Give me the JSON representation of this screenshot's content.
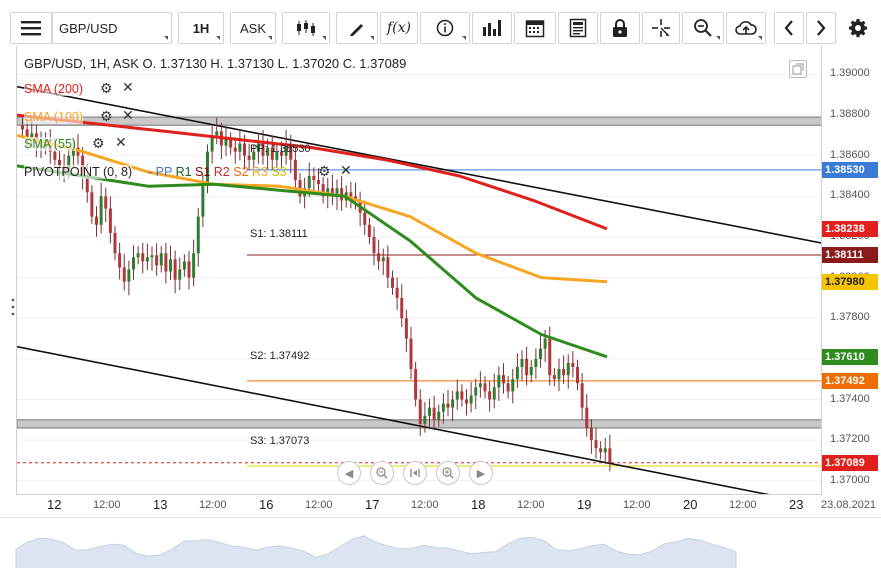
{
  "toolbar": {
    "symbol": "GBP/USD",
    "timeframe": "1H",
    "price_type": "ASK",
    "icons": [
      "menu-icon",
      "candles-icon",
      "draw-pencil-icon",
      "function-icon",
      "info-icon",
      "bar-chart-icon",
      "calendar-icon",
      "document-icon",
      "lock-icon",
      "crosshair-icon",
      "zoom-icon",
      "cloud-upload-icon",
      "chevron-left-icon",
      "chevron-right-icon",
      "gear-icon"
    ]
  },
  "ohlc": {
    "text": "GBP/USD, 1H, ASK    O. 1.37130  H. 1.37130  L. 1.37020  C. 1.37089"
  },
  "indicators": [
    {
      "label": "SMA (200)",
      "color": "#e0201c"
    },
    {
      "label": "SMA (100)",
      "color": "#f5a623"
    },
    {
      "label": "SMA (55)",
      "color": "#2e8b1e"
    },
    {
      "label": "PIVOTPOINT (0, 8)",
      "color": "#222222"
    }
  ],
  "pivot_legend": [
    {
      "label": "PP",
      "color": "#3a7bd5"
    },
    {
      "label": "R1",
      "color": "#1b5e20"
    },
    {
      "label": "S1",
      "color": "#8b0000"
    },
    {
      "label": "R2",
      "color": "#c62828"
    },
    {
      "label": "S2",
      "color": "#ef6c00"
    },
    {
      "label": "R3",
      "color": "#f9a825"
    },
    {
      "label": "S3",
      "color": "#d4c000"
    }
  ],
  "levels": [
    {
      "name": "PP",
      "label": "PP: 1.38530",
      "value": 1.3853,
      "color": "#3a7bd5"
    },
    {
      "name": "S1",
      "label": "S1: 1.38111",
      "value": 1.38111,
      "color": "#8b1a1a"
    },
    {
      "name": "S2",
      "label": "S2: 1.37492",
      "value": 1.37492,
      "color": "#ef6c00"
    },
    {
      "name": "S3",
      "label": "S3: 1.37073",
      "value": 1.37073,
      "color": "#e6d800"
    }
  ],
  "price_badges": [
    {
      "text": "1.38530",
      "value": 1.3853,
      "color": "#3a7bd5"
    },
    {
      "text": "1.38238",
      "value": 1.38238,
      "color": "#e0201c"
    },
    {
      "text": "1.38111",
      "value": 1.38111,
      "color": "#8b1a1a"
    },
    {
      "text": "1.37980",
      "value": 1.3798,
      "color": "#f5c400"
    },
    {
      "text": "1.37610",
      "value": 1.3761,
      "color": "#2e8b1e"
    },
    {
      "text": "1.37492",
      "value": 1.37492,
      "color": "#ef6c00"
    },
    {
      "text": "1.37089",
      "value": 1.37089,
      "color": "#e0201c"
    }
  ],
  "yaxis": {
    "ticks": [
      "1.39000",
      "1.38800",
      "1.38600",
      "1.38400",
      "1.38200",
      "1.38000",
      "1.37800",
      "1.37600",
      "1.37400",
      "1.37200",
      "1.37000"
    ],
    "values": [
      1.39,
      1.388,
      1.386,
      1.384,
      1.382,
      1.38,
      1.378,
      1.376,
      1.374,
      1.372,
      1.37
    ]
  },
  "xaxis": {
    "labels": [
      {
        "text": "12",
        "day": true
      },
      {
        "text": "12:00",
        "day": false
      },
      {
        "text": "13",
        "day": true
      },
      {
        "text": "12:00",
        "day": false
      },
      {
        "text": "16",
        "day": true
      },
      {
        "text": "12:00",
        "day": false
      },
      {
        "text": "17",
        "day": true
      },
      {
        "text": "12:00",
        "day": false
      },
      {
        "text": "18",
        "day": true
      },
      {
        "text": "12:00",
        "day": false
      },
      {
        "text": "19",
        "day": true
      },
      {
        "text": "12:00",
        "day": false
      },
      {
        "text": "20",
        "day": true
      },
      {
        "text": "12:00",
        "day": false
      },
      {
        "text": "23",
        "day": true
      },
      {
        "text": "23.08.2021",
        "day": false
      }
    ]
  },
  "chart_data": {
    "type": "candlestick",
    "symbol": "GBP/USD",
    "interval": "1H",
    "ylim": [
      1.3693,
      1.3914
    ],
    "last_close": 1.37089,
    "closes": [
      1.3873,
      1.3869,
      1.3871,
      1.3866,
      1.3864,
      1.3868,
      1.3862,
      1.3858,
      1.3855,
      1.3852,
      1.386,
      1.3864,
      1.386,
      1.385,
      1.3842,
      1.383,
      1.3826,
      1.384,
      1.3834,
      1.3822,
      1.3812,
      1.3805,
      1.3798,
      1.3804,
      1.381,
      1.3812,
      1.3808,
      1.381,
      1.3811,
      1.3806,
      1.3812,
      1.3803,
      1.3809,
      1.3799,
      1.3804,
      1.3808,
      1.38,
      1.3812,
      1.383,
      1.3845,
      1.3862,
      1.387,
      1.3872,
      1.3865,
      1.3868,
      1.3864,
      1.3862,
      1.3866,
      1.386,
      1.3858,
      1.3862,
      1.3866,
      1.386,
      1.3864,
      1.3858,
      1.3862,
      1.386,
      1.3866,
      1.3858,
      1.3848,
      1.384,
      1.3844,
      1.385,
      1.3848,
      1.3846,
      1.384,
      1.3844,
      1.384,
      1.3844,
      1.3838,
      1.3842,
      1.384,
      1.3838,
      1.3832,
      1.3826,
      1.382,
      1.3812,
      1.3808,
      1.381,
      1.38,
      1.3795,
      1.379,
      1.378,
      1.377,
      1.3755,
      1.374,
      1.3728,
      1.3732,
      1.3736,
      1.373,
      1.3734,
      1.3738,
      1.3736,
      1.374,
      1.3744,
      1.374,
      1.3738,
      1.3742,
      1.3746,
      1.3748,
      1.3744,
      1.374,
      1.3746,
      1.3752,
      1.3748,
      1.3744,
      1.375,
      1.3756,
      1.376,
      1.3752,
      1.3756,
      1.376,
      1.3765,
      1.377,
      1.3752,
      1.375,
      1.3755,
      1.3752,
      1.3758,
      1.3756,
      1.3748,
      1.3736,
      1.3726,
      1.372,
      1.3716,
      1.3714,
      1.3716,
      1.3709
    ],
    "sma200": {
      "x0": 0,
      "values": [
        1.388,
        1.3876,
        1.3872,
        1.3868,
        1.3864,
        1.3858,
        1.385,
        1.3838,
        1.3824
      ]
    },
    "sma100": {
      "x0": 0,
      "values": [
        1.387,
        1.3862,
        1.3852,
        1.3846,
        1.3845,
        1.384,
        1.383,
        1.3812,
        1.38,
        1.3798
      ]
    },
    "sma55": {
      "x0": 0,
      "values": [
        1.3855,
        1.385,
        1.3845,
        1.3846,
        1.3843,
        1.384,
        1.3818,
        1.379,
        1.3772,
        1.3761
      ]
    },
    "trendlines": [
      {
        "from": [
          0,
          1.3894
        ],
        "to": [
          805,
          1.3817
        ]
      },
      {
        "from": [
          0,
          1.3766
        ],
        "to": [
          805,
          1.3688
        ]
      }
    ],
    "zones": [
      {
        "from": 1.3879,
        "to": 1.3875
      },
      {
        "from": 1.373,
        "to": 1.3726
      }
    ]
  },
  "zoombar": [
    "prev-icon",
    "zoom-out-icon",
    "fit-icon",
    "zoom-in-icon",
    "next-icon"
  ]
}
